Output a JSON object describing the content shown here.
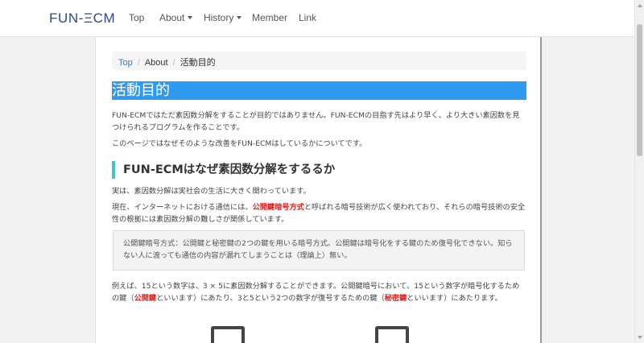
{
  "navbar": {
    "brand": "FUN-ΞCM",
    "items": [
      {
        "label": "Top",
        "has_caret": false
      },
      {
        "label": "About",
        "has_caret": true
      },
      {
        "label": "History",
        "has_caret": true
      },
      {
        "label": "Member",
        "has_caret": false
      },
      {
        "label": "Link",
        "has_caret": false
      }
    ]
  },
  "breadcrumb": {
    "items": [
      "Top",
      "About",
      "活動目的"
    ]
  },
  "page_title": "活動目的",
  "intro": {
    "p1": "FUN-ECMではただ素因数分解をすることが目的ではありません。FUN-ECMの目指す先はより早く、より大きい素因数を見つけられるプログラムを作ることです。",
    "p2": "このページではなぜそのような改善をFUN-ECMはしているかについてです。"
  },
  "section": {
    "heading": "FUN-ECMはなぜ素因数分解をするるか",
    "p1": "実は、素因数分解は実社会の生活に大きく関わっています。",
    "p2_before": "現在、インターネットにおける通信には、",
    "p2_highlight": "公開鍵暗号方式",
    "p2_after": "と呼ばれる暗号技術が広く使われており、それらの暗号技術の安全性の根拠には素因数分解の難しさが関係しています。"
  },
  "quote": {
    "text": "公開鍵暗号方式：公開鍵と秘密鍵の2つの鍵を用いる暗号方式。公開鍵は暗号化をする鍵のため復号化できない。知らない人に渡っても通信の内容が漏れてしまうことは（理論上）無い。"
  },
  "example": {
    "line1": "例えば、15という数字は、3 × 5に素因数分解することができます。公開鍵暗号において、15という数字が暗号化するための鍵（",
    "public_key": "公開鍵",
    "line2": "といいます）にあたり、3と5という2つの数字が復号するための鍵（",
    "private_key": "秘密鍵",
    "line3": "といいます）にあたります。"
  },
  "colors": {
    "title_bg": "#2e9bf0",
    "section_accent": "#3cc6c8",
    "highlight": "#e02020",
    "brand": "#2b4a86",
    "link": "#337ab7"
  }
}
